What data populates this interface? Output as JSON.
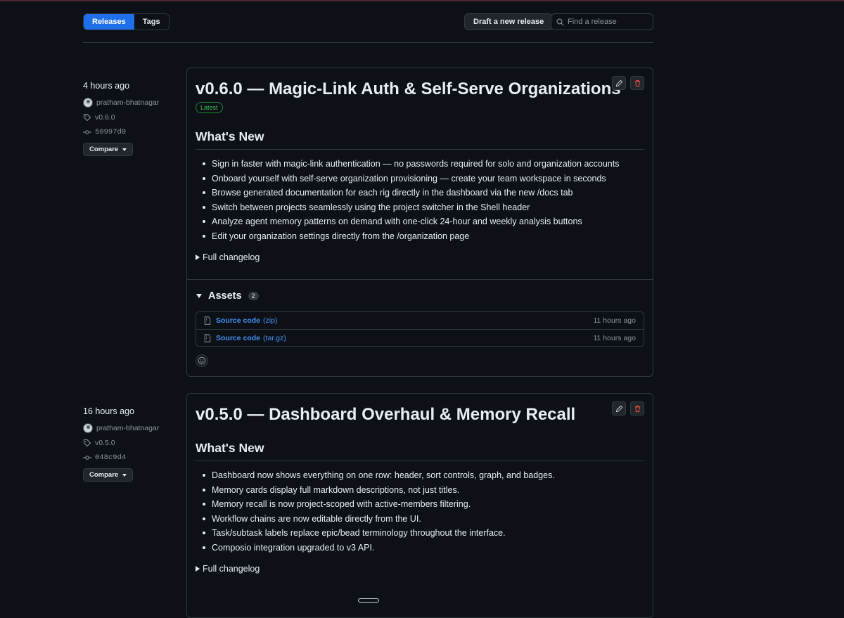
{
  "header": {
    "tabs": [
      {
        "label": "Releases",
        "active": true
      },
      {
        "label": "Tags",
        "active": false
      }
    ],
    "draft_label": "Draft a new release",
    "search_placeholder": "Find a release"
  },
  "releases": [
    {
      "time": "4 hours ago",
      "author": "pratham-bhatnagar",
      "tag": "v0.6.0",
      "commit": "50997d0",
      "compare_label": "Compare",
      "title": "v0.6.0 — Magic-Link Auth & Self-Serve Organizations",
      "latest_label": "Latest",
      "section_title": "What's New",
      "notes": [
        "Sign in faster with magic-link authentication — no passwords required for solo and organization accounts",
        "Onboard yourself with self-serve organization provisioning — create your team workspace in seconds",
        "Browse generated documentation for each rig directly in the dashboard via the new /docs tab",
        "Switch between projects seamlessly using the project switcher in the Shell header",
        "Analyze agent memory patterns on demand with one-click 24-hour and weekly analysis buttons",
        "Edit your organization settings directly from the /organization page"
      ],
      "changelog_label": "Full changelog",
      "assets": {
        "title": "Assets",
        "count": "2",
        "items": [
          {
            "name": "Source code",
            "ext": "(zip)",
            "time": "11 hours ago"
          },
          {
            "name": "Source code",
            "ext": "(tar.gz)",
            "time": "11 hours ago"
          }
        ]
      }
    },
    {
      "time": "16 hours ago",
      "author": "pratham-bhatnagar",
      "tag": "v0.5.0",
      "commit": "048c9d4",
      "compare_label": "Compare",
      "title": "v0.5.0 — Dashboard Overhaul & Memory Recall",
      "section_title": "What's New",
      "notes": [
        "Dashboard now shows everything on one row: header, sort controls, graph, and badges.",
        "Memory cards display full markdown descriptions, not just titles.",
        "Memory recall is now project-scoped with active-members filtering.",
        "Workflow chains are now editable directly from the UI.",
        "Task/subtask labels replace epic/bead terminology throughout the interface.",
        "Composio integration upgraded to v3 API."
      ],
      "changelog_label": "Full changelog"
    }
  ],
  "colors": {
    "background": "#0d1117",
    "border": "#30363d",
    "accent": "#1f6feb",
    "link": "#4493f8",
    "latest_badge": "#3fb950",
    "danger": "#f85149"
  }
}
